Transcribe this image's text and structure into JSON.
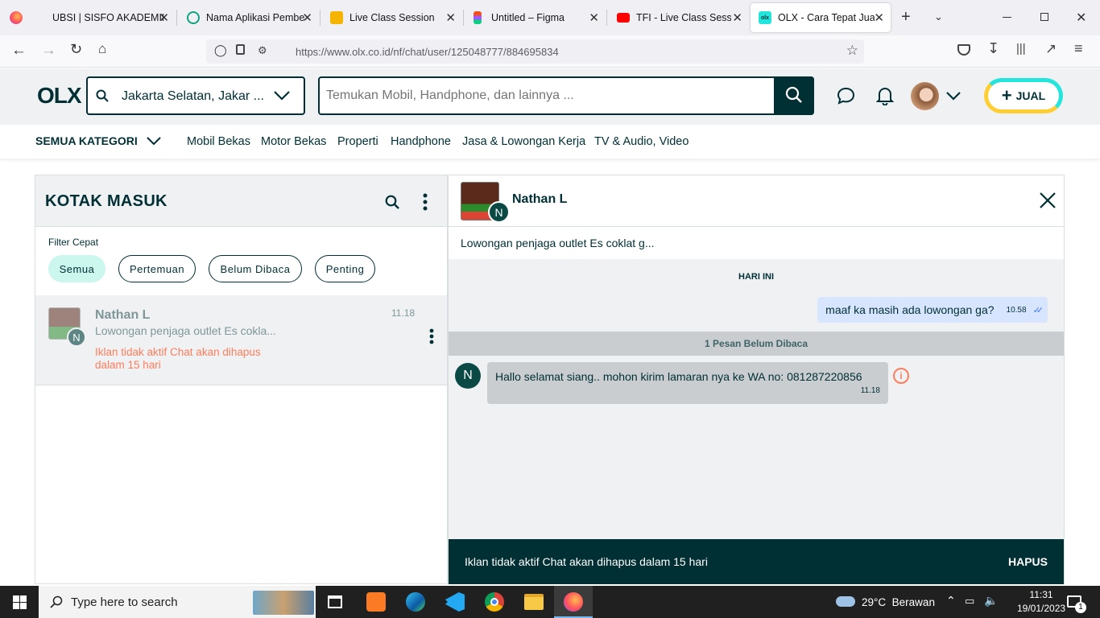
{
  "browser": {
    "tabs": [
      {
        "title": "UBSI | SISFO AKADEMIK MAH"
      },
      {
        "title": "Nama Aplikasi Pembelajaran"
      },
      {
        "title": "Live Class Session"
      },
      {
        "title": "Untitled – Figma"
      },
      {
        "title": "TFI - Live Class Session"
      },
      {
        "title": "OLX - Cara Tepat Jual Cepat"
      }
    ],
    "url": "https://www.olx.co.id/nf/chat/user/125048777/884695834"
  },
  "header": {
    "logo": "OLX",
    "location_value": "Jakarta Selatan, Jakar ...",
    "search_placeholder": "Temukan Mobil, Handphone, dan lainnya ...",
    "sell_label": "JUAL"
  },
  "categories": {
    "all_label": "SEMUA KATEGORI",
    "items": [
      "Mobil Bekas",
      "Motor Bekas",
      "Properti",
      "Handphone",
      "Jasa & Lowongan Kerja",
      "TV & Audio, Video"
    ]
  },
  "inbox": {
    "title": "KOTAK MASUK",
    "filter_label": "Filter Cepat",
    "filters": [
      "Semua",
      "Pertemuan",
      "Belum Dibaca",
      "Penting"
    ],
    "conversations": [
      {
        "name": "Nathan L",
        "initial": "N",
        "time": "11.18",
        "preview": "Lowongan penjaga outlet Es cokla...",
        "warning_line1": "Iklan tidak aktif Chat akan dihapus",
        "warning_line2": "dalam 15 hari"
      }
    ]
  },
  "chat": {
    "name": "Nathan L",
    "initial": "N",
    "ad_title": "Lowongan penjaga outlet Es coklat g...",
    "day_label": "HARI INI",
    "sent_message": {
      "text": "maaf ka masih ada lowongan ga?",
      "time": "10.58"
    },
    "unread_label": "1 Pesan Belum Dibaca",
    "received_message": {
      "text": "Hallo selamat siang.. mohon kirim lamaran nya ke WA no: 081287220856",
      "time": "11.18"
    },
    "footer_text": "Iklan tidak aktif Chat akan dihapus dalam 15 hari",
    "footer_action": "HAPUS"
  },
  "taskbar": {
    "search_placeholder": "Type here to search",
    "weather": "29°C  Berawan",
    "time": "11:31",
    "date": "19/01/2023",
    "notification_count": "1"
  },
  "colors": {
    "brand_dark": "#002f34",
    "brand_teal": "#23e5db",
    "brand_yellow": "#ffce32",
    "warning": "#ff7d5c"
  }
}
